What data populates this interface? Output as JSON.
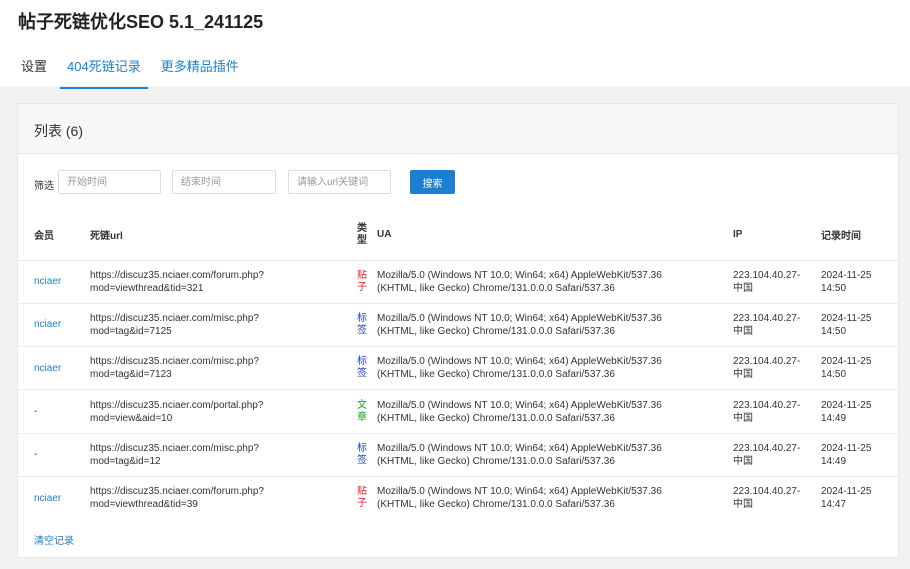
{
  "page": {
    "title": "帖子死链优化SEO 5.1_241125"
  },
  "tabs": [
    {
      "label": "设置"
    },
    {
      "label": "404死链记录"
    },
    {
      "label": "更多精品插件"
    }
  ],
  "panel": {
    "title": "列表 (6)"
  },
  "filter": {
    "label": "筛选",
    "start_placeholder": "开始时间",
    "end_placeholder": "结束时间",
    "keyword_placeholder": "请输入url关键词",
    "search_label": "搜索"
  },
  "table": {
    "headers": {
      "member": "会员",
      "url": "死链url",
      "type_1": "类",
      "type_2": "型",
      "ua": "UA",
      "ip": "IP",
      "time": "记录时间"
    },
    "rows": [
      {
        "member": "nciaer",
        "url_1": "https://discuz35.nciaer.com/forum.php?",
        "url_2": "mod=viewthread&tid=321",
        "type_1": "贴",
        "type_2": "子",
        "ua_1": "Mozilla/5.0 (Windows NT 10.0; Win64; x64) AppleWebKit/537.36",
        "ua_2": "(KHTML, like Gecko) Chrome/131.0.0.0 Safari/537.36",
        "ip_1": "223.104.40.27-",
        "ip_2": "中国",
        "time_1": "2024-11-25",
        "time_2": "14:50"
      },
      {
        "member": "nciaer",
        "url_1": "https://discuz35.nciaer.com/misc.php?",
        "url_2": "mod=tag&id=7125",
        "type_1": "标",
        "type_2": "签",
        "ua_1": "Mozilla/5.0 (Windows NT 10.0; Win64; x64) AppleWebKit/537.36",
        "ua_2": "(KHTML, like Gecko) Chrome/131.0.0.0 Safari/537.36",
        "ip_1": "223.104.40.27-",
        "ip_2": "中国",
        "time_1": "2024-11-25",
        "time_2": "14:50"
      },
      {
        "member": "nciaer",
        "url_1": "https://discuz35.nciaer.com/misc.php?",
        "url_2": "mod=tag&id=7123",
        "type_1": "标",
        "type_2": "签",
        "ua_1": "Mozilla/5.0 (Windows NT 10.0; Win64; x64) AppleWebKit/537.36",
        "ua_2": "(KHTML, like Gecko) Chrome/131.0.0.0 Safari/537.36",
        "ip_1": "223.104.40.27-",
        "ip_2": "中国",
        "time_1": "2024-11-25",
        "time_2": "14:50"
      },
      {
        "member": "-",
        "url_1": "https://discuz35.nciaer.com/portal.php?",
        "url_2": "mod=view&aid=10",
        "type_1": "文",
        "type_2": "章",
        "ua_1": "Mozilla/5.0 (Windows NT 10.0; Win64; x64) AppleWebKit/537.36",
        "ua_2": "(KHTML, like Gecko) Chrome/131.0.0.0 Safari/537.36",
        "ip_1": "223.104.40.27-",
        "ip_2": "中国",
        "time_1": "2024-11-25",
        "time_2": "14:49"
      },
      {
        "member": "-",
        "url_1": "https://discuz35.nciaer.com/misc.php?",
        "url_2": "mod=tag&id=12",
        "type_1": "标",
        "type_2": "签",
        "ua_1": "Mozilla/5.0 (Windows NT 10.0; Win64; x64) AppleWebKit/537.36",
        "ua_2": "(KHTML, like Gecko) Chrome/131.0.0.0 Safari/537.36",
        "ip_1": "223.104.40.27-",
        "ip_2": "中国",
        "time_1": "2024-11-25",
        "time_2": "14:49"
      },
      {
        "member": "nciaer",
        "url_1": "https://discuz35.nciaer.com/forum.php?",
        "url_2": "mod=viewthread&tid=39",
        "type_1": "贴",
        "type_2": "子",
        "ua_1": "Mozilla/5.0 (Windows NT 10.0; Win64; x64) AppleWebKit/537.36",
        "ua_2": "(KHTML, like Gecko) Chrome/131.0.0.0 Safari/537.36",
        "ip_1": "223.104.40.27-",
        "ip_2": "中国",
        "time_1": "2024-11-25",
        "time_2": "14:47"
      }
    ]
  },
  "footer": {
    "clear_label": "清空记录"
  },
  "colors": {
    "accent": "#1e7fd0",
    "type_post": "#e0201b",
    "type_tag": "#1e3fd0",
    "type_article": "#17a017"
  }
}
